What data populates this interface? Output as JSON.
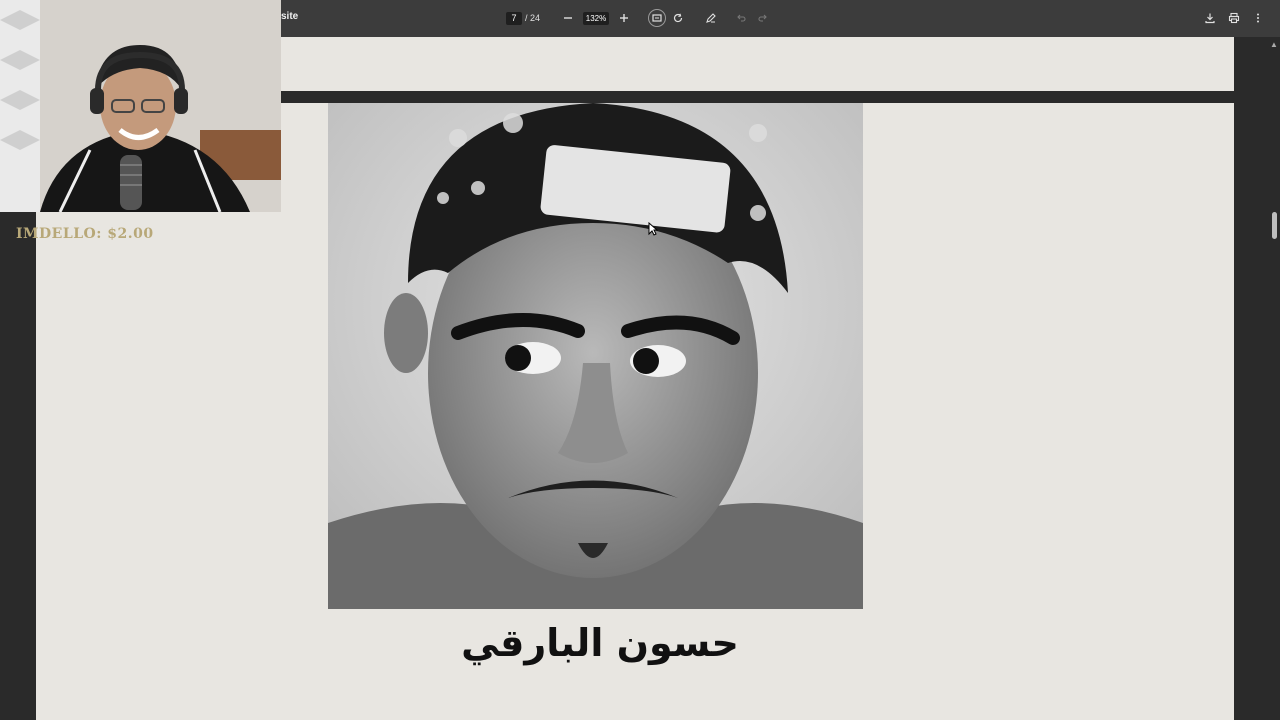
{
  "toolbar": {
    "title": "site",
    "page_current": "7",
    "page_total": "/ 24",
    "zoom": "132%"
  },
  "page": {
    "caption": "حسون البارقي"
  },
  "overlay": {
    "donation": "IMDELLO: $2.00"
  },
  "icons": {
    "zoom_out": "minus-icon",
    "zoom_in": "plus-icon",
    "fit": "fit-page-icon",
    "rotate": "rotate-icon",
    "annotate": "annotate-pen-icon",
    "undo": "undo-icon",
    "redo": "redo-icon",
    "download": "download-icon",
    "print": "print-icon",
    "more": "more-vert-icon"
  },
  "colors": {
    "toolbar": "#3c3c3c",
    "viewer_bg": "#2a2a2a",
    "page_bg": "#e8e6e1",
    "donation_text": "#b8a878"
  }
}
